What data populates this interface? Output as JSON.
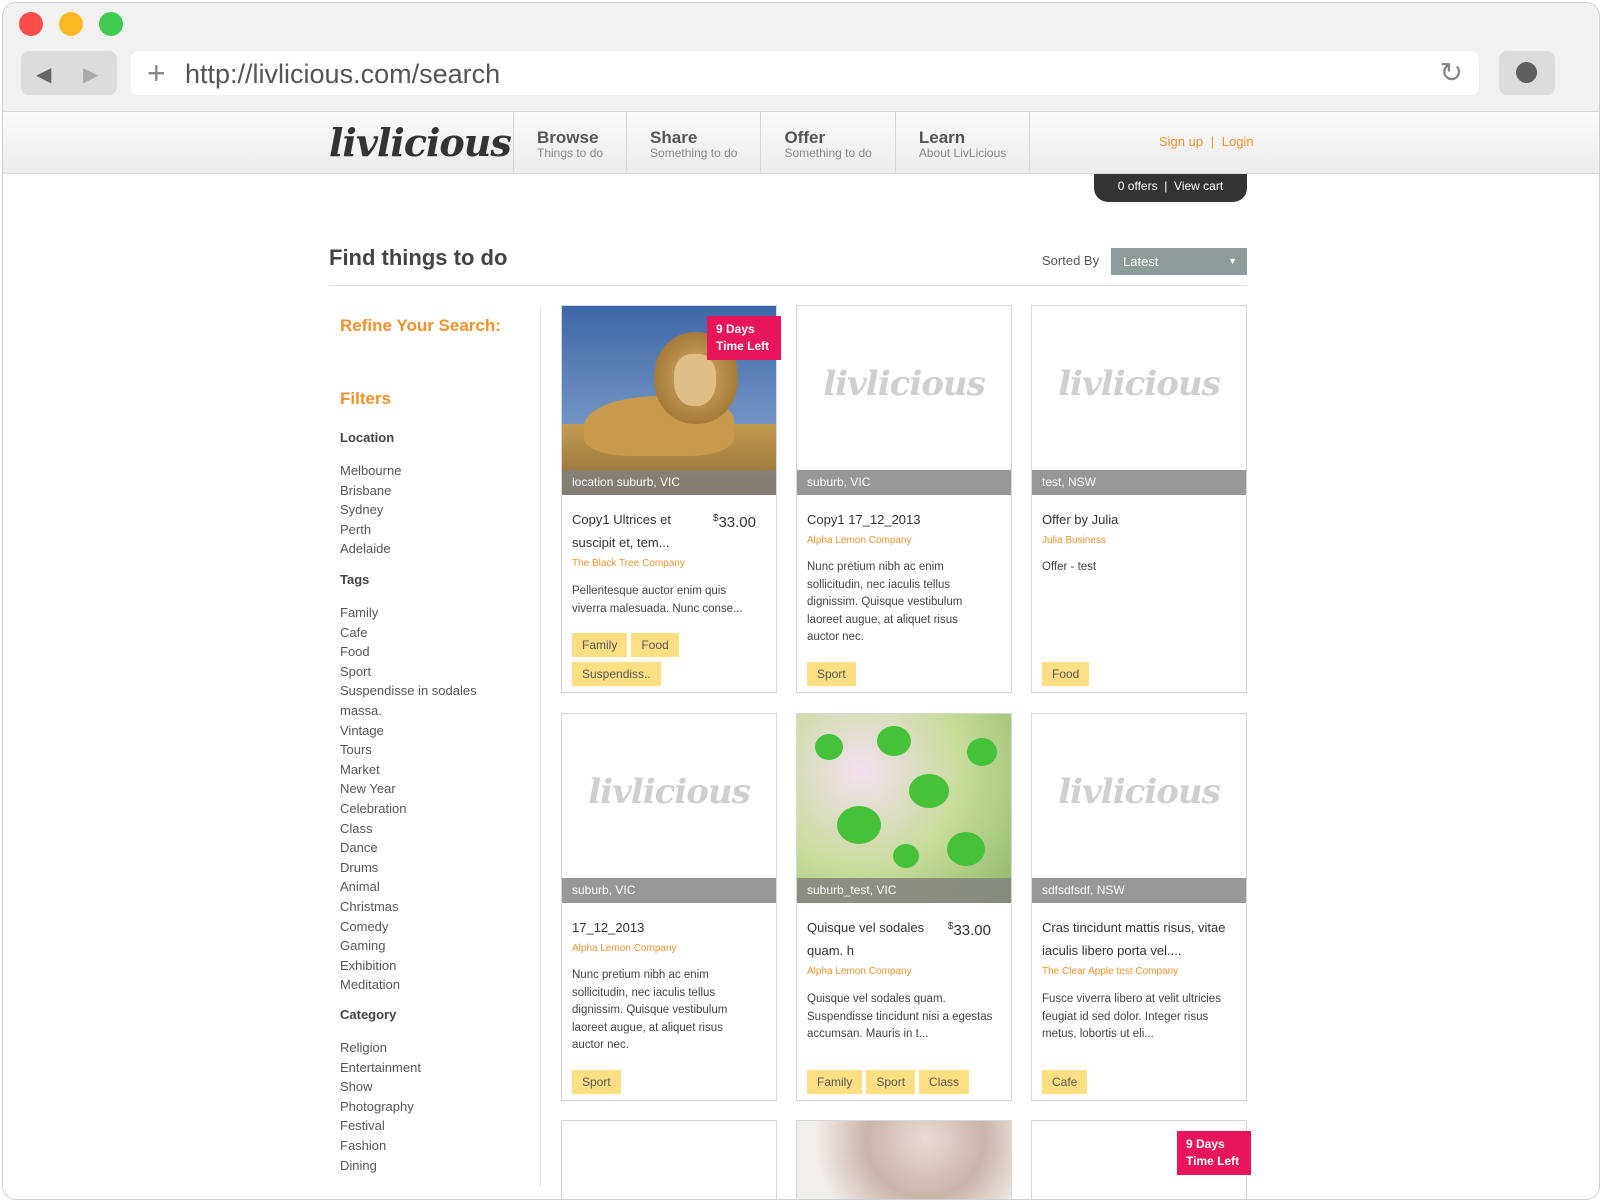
{
  "browser": {
    "url": "http://livlicious.com/search"
  },
  "site": {
    "logo": "livlicious",
    "nav": [
      {
        "title": "Browse",
        "sub": "Things to do"
      },
      {
        "title": "Share",
        "sub": "Something to do"
      },
      {
        "title": "Offer",
        "sub": "Something to do"
      },
      {
        "title": "Learn",
        "sub": "About LivLicious"
      }
    ],
    "signup": "Sign up",
    "separator": "|",
    "login": "Login",
    "cart": "0 offers  |  View cart"
  },
  "page": {
    "title": "Find things to do",
    "sorted_by_label": "Sorted By",
    "sort_value": "Latest"
  },
  "sidebar": {
    "refine": "Refine Your Search:",
    "filters": "Filters",
    "location_title": "Location",
    "locations": [
      "Melbourne",
      "Brisbane",
      "Sydney",
      "Perth",
      "Adelaide"
    ],
    "tags_title": "Tags",
    "tags": [
      "Family",
      "Cafe",
      "Food",
      "Sport",
      "Suspendisse in sodales",
      "massa.",
      "Vintage",
      "Tours",
      "Market",
      "New Year",
      "Celebration",
      "Class",
      "Dance",
      "Drums",
      "Animal",
      "Christmas",
      "Comedy",
      "Gaming",
      "Exhibition",
      "Meditation"
    ],
    "category_title": "Category",
    "categories": [
      "Religion",
      "Entertainment",
      "Show",
      "Photography",
      "Festival",
      "Fashion",
      "Dining"
    ]
  },
  "cards": [
    {
      "badge1": "9 Days",
      "badge2": "Time Left",
      "location": "location suburb, VIC",
      "name": "Copy1 Ultrices et suscipit et, tem...",
      "price_symbol": "$",
      "price": "33.00",
      "business": "The Black Tree Company",
      "desc": "Pellentesque auctor enim quis viverra malesuada. Nunc conse...",
      "tags": [
        "Family",
        "Food",
        "Suspendiss.."
      ]
    },
    {
      "placeholder": "livlicious",
      "location": "suburb, VIC",
      "name": "Copy1 17_12_2013",
      "business": "Alpha Lemon Company",
      "desc": "Nunc pretium nibh ac enim sollicitudin, nec iaculis tellus dignissim. Quisque vestibulum laoreet augue, at aliquet risus auctor nec.",
      "tags": [
        "Sport"
      ]
    },
    {
      "placeholder": "livlicious",
      "location": "test, NSW",
      "name": "Offer by Julia",
      "business": "Julia Business",
      "desc": "Offer - test",
      "tags": [
        "Food"
      ]
    },
    {
      "placeholder": "livlicious",
      "location": "suburb, VIC",
      "name": "17_12_2013",
      "business": "Alpha Lemon Company",
      "desc": "Nunc pretium nibh ac enim sollicitudin, nec iaculis tellus dignissim. Quisque vestibulum laoreet augue, at aliquet risus auctor nec.",
      "tags": [
        "Sport"
      ]
    },
    {
      "location": "suburb_test, VIC",
      "name": "Quisque vel sodales quam. h",
      "price_symbol": "$",
      "price": "33.00",
      "business": "Alpha Lemon Company",
      "desc": "Quisque vel sodales quam. Suspendisse tincidunt nisi a egestas accumsan. Mauris in t...",
      "tags": [
        "Family",
        "Sport",
        "Class"
      ]
    },
    {
      "placeholder": "livlicious",
      "location": "sdfsdfsdf, NSW",
      "name": "Cras tincidunt mattis risus, vitae iaculis libero porta vel....",
      "business": "The Clear Apple test Company",
      "desc": "Fusce viverra libero at velit ultricies feugiat id sed dolor. Integer risus metus, lobortis ut eli...",
      "tags": [
        "Cafe"
      ]
    },
    {
      "badge1": "9 Days",
      "badge2": "Time Left"
    }
  ]
}
